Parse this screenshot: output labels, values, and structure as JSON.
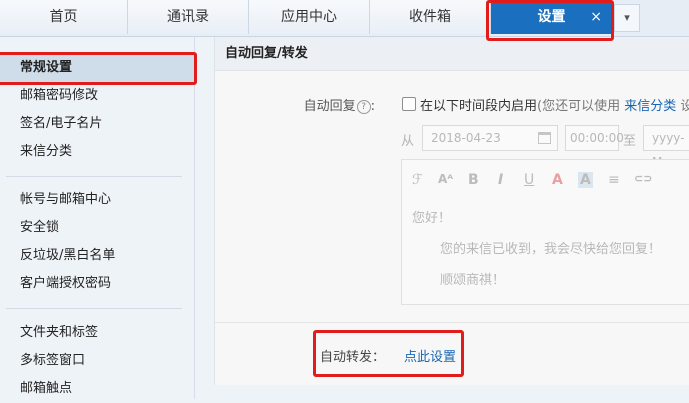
{
  "tabs": [
    {
      "label": "首页"
    },
    {
      "label": "通讯录"
    },
    {
      "label": "应用中心"
    },
    {
      "label": "收件箱"
    },
    {
      "label": "设置",
      "active": true,
      "close": "×"
    }
  ],
  "tab_more_icon": "chevron-down-icon",
  "sidebar": {
    "items": [
      {
        "label": "常规设置",
        "active": true
      },
      {
        "label": "邮箱密码修改"
      },
      {
        "label": "签名/电子名片"
      },
      {
        "label": "来信分类"
      },
      {
        "label": "帐号与邮箱中心"
      },
      {
        "label": "安全锁"
      },
      {
        "label": "反垃圾/黑白名单"
      },
      {
        "label": "客户端授权密码"
      },
      {
        "label": "文件夹和标签"
      },
      {
        "label": "多标签窗口"
      },
      {
        "label": "邮箱触点"
      }
    ]
  },
  "main": {
    "section_title": "自动回复/转发",
    "auto_reply": {
      "label": "自动回复",
      "help": "?",
      "checkbox_label": "在以下时间段内启用",
      "hint_prefix": "(您还可以使用",
      "hint_link": "来信分类",
      "hint_suffix": "设置",
      "from_label": "从",
      "start_date": "2018-04-23",
      "start_time": "00:00:00",
      "to_label": "至",
      "end_placeholder": "yyyy-M"
    },
    "editor": {
      "toolbar": [
        "font-icon",
        "font-size-icon",
        "bold-icon",
        "italic-icon",
        "underline-icon",
        "font-color-icon",
        "background-color-icon",
        "align-icon",
        "link-icon"
      ],
      "toolbar_glyphs": [
        "ℱ",
        "Aᴬ",
        "B",
        "I",
        "U",
        "A",
        "A",
        "≡",
        "⊂⊃"
      ],
      "greeting": "您好！",
      "body": "您的来信已收到，我会尽快给您回复！",
      "closing": "顺颂商祺！"
    },
    "auto_forward": {
      "label": "自动转发：",
      "link": "点此设置"
    }
  },
  "colors": {
    "accent": "#1b6fbf",
    "highlight": "#e21b1b",
    "link": "#1766b3"
  }
}
